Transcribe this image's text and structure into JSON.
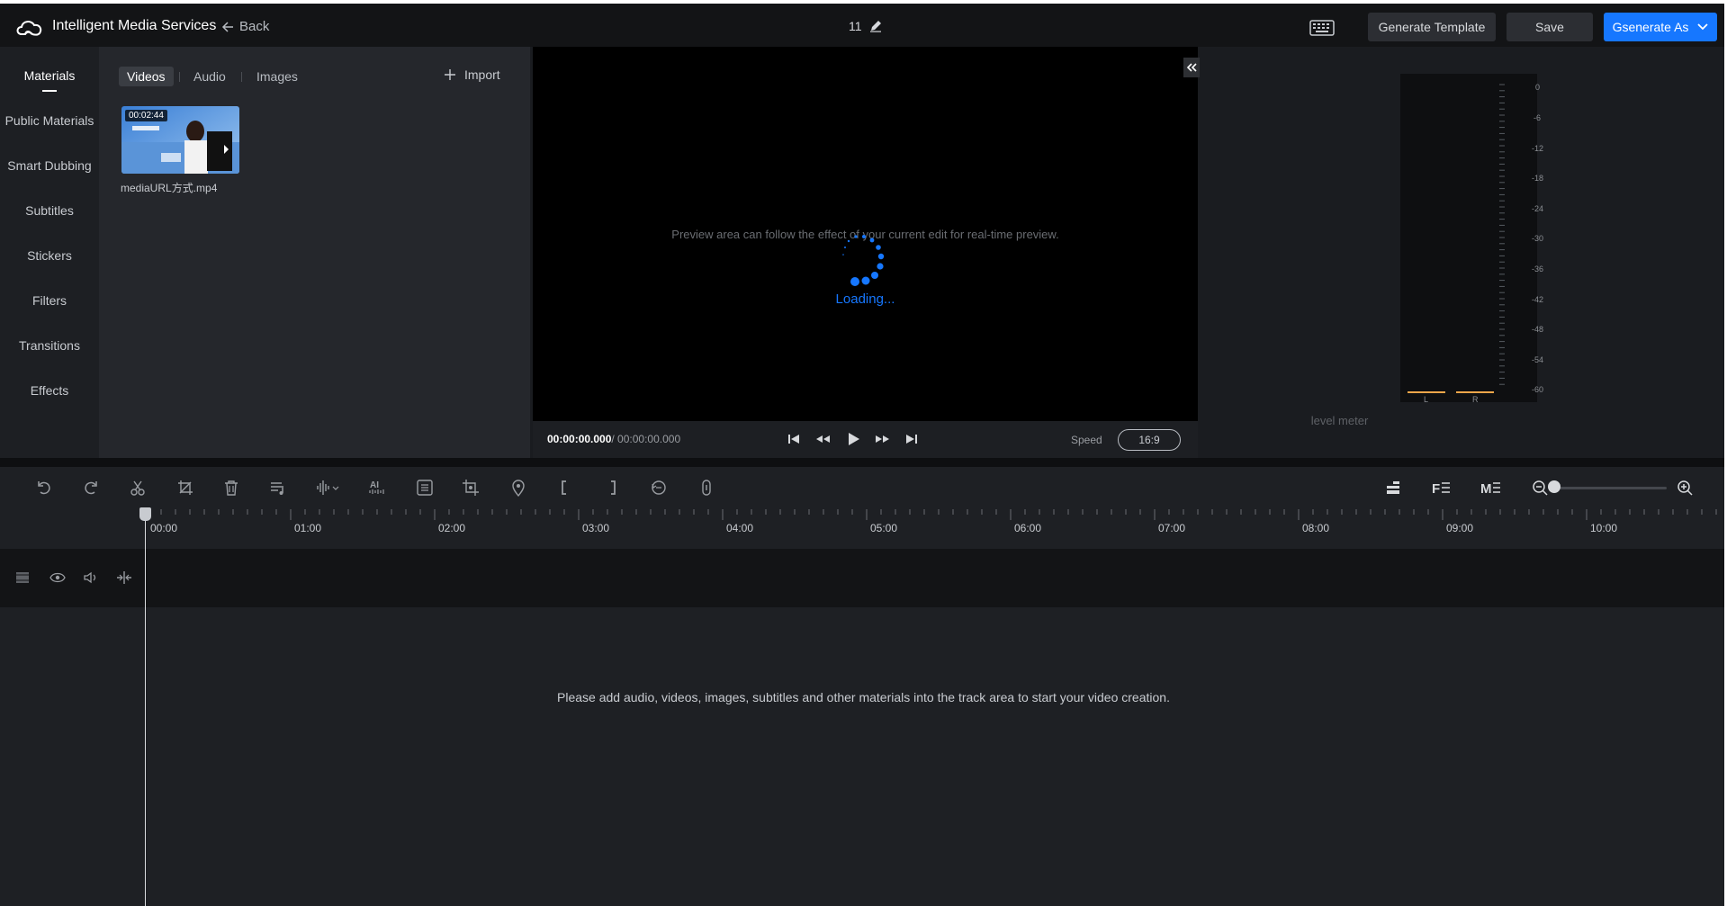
{
  "app": {
    "brand": "Intelligent Media Services",
    "back_label": "Back",
    "project_name": "11",
    "generate_template_label": "Generate Template",
    "save_label": "Save",
    "generate_as_label": "Gsenerate As",
    "accent_color": "#1677ff"
  },
  "leftnav": {
    "items": [
      {
        "label": "Materials",
        "active": true
      },
      {
        "label": "Public Materials"
      },
      {
        "label": "Smart Dubbing"
      },
      {
        "label": "Subtitles"
      },
      {
        "label": "Stickers"
      },
      {
        "label": "Filters"
      },
      {
        "label": "Transitions"
      },
      {
        "label": "Effects"
      }
    ]
  },
  "materials": {
    "tabs": [
      "Videos",
      "Audio",
      "Images"
    ],
    "active_tab": "Videos",
    "import_label": "Import",
    "items": [
      {
        "duration": "00:02:44",
        "name": "mediaURL方式.mp4"
      }
    ]
  },
  "preview": {
    "hint": "Preview area can follow the effect of your current edit for real-time preview.",
    "loading": "Loading...",
    "current_time": "00:00:00.000",
    "total_time": "/ 00:00:00.000",
    "speed_label": "Speed",
    "ratio": "16:9"
  },
  "level_meter": {
    "label": "level meter",
    "ticks": [
      "0",
      "-6",
      "-12",
      "-18",
      "-24",
      "-30",
      "-36",
      "-42",
      "-48",
      "-54",
      "-60"
    ],
    "channels": [
      "L",
      "R"
    ]
  },
  "timeline": {
    "ruler_labels": [
      "00:00",
      "01:00",
      "02:00",
      "03:00",
      "04:00",
      "05:00",
      "06:00",
      "07:00",
      "08:00",
      "09:00",
      "10:00"
    ],
    "empty_hint": "Please add audio, videos, images, subtitles and other materials into the track area to start your video creation.",
    "zoom_level": 0
  }
}
